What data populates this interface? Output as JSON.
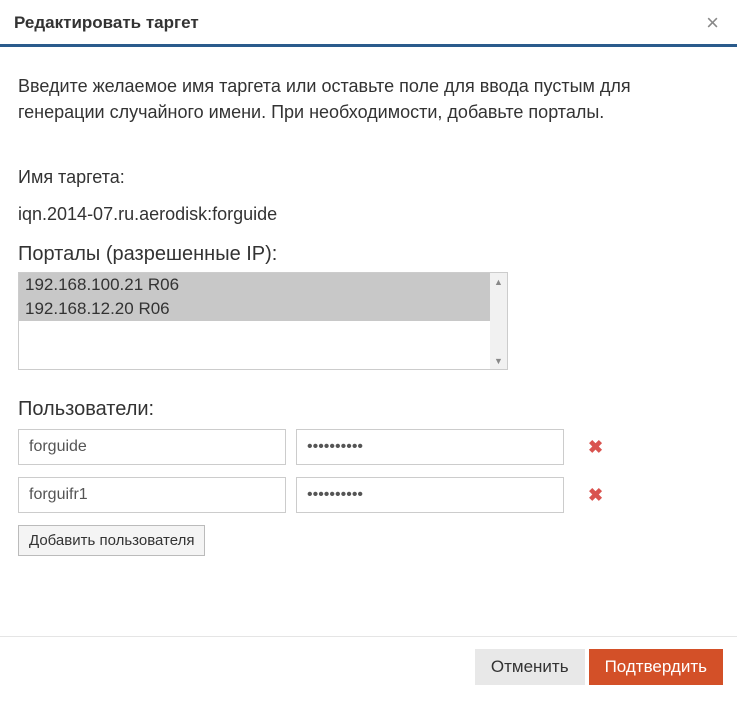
{
  "dialog": {
    "title": "Редактировать таргет",
    "instruction": "Введите желаемое имя таргета или оставьте поле для ввода пустым для генерации случайного имени. При необходимости, добавьте порталы.",
    "target_name_label": "Имя таргета:",
    "target_name_value": "iqn.2014-07.ru.aerodisk:forguide",
    "portals_label": "Порталы (разрешенные IP):",
    "portals": [
      "192.168.100.21 R06",
      "192.168.12.20 R06"
    ],
    "users_label": "Пользователи:",
    "users": [
      {
        "username": "forguide",
        "password": "••••••••••"
      },
      {
        "username": "forguifr1",
        "password": "••••••••••"
      }
    ],
    "add_user_label": "Добавить пользователя",
    "cancel_label": "Отменить",
    "confirm_label": "Подтвердить"
  }
}
